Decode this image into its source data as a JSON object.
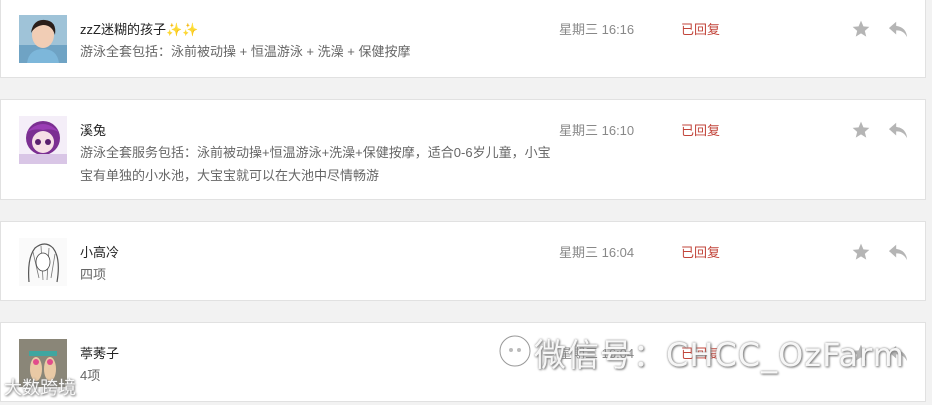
{
  "messages": [
    {
      "name": "zzZ迷糊的孩子✨✨",
      "text": "游泳全套包括：泳前被动操 + 恒温游泳 + 洗澡 + 保健按摩",
      "time": "星期三 16:16",
      "status": "已回复",
      "avatar": "photo-avatar-woman"
    },
    {
      "name": "溪兔",
      "text": "游泳全套服务包括：泳前被动操+恒温游泳+洗澡+保健按摩，适合0-6岁儿童，小宝宝有单独的小水池，大宝宝就可以在大池中尽情畅游",
      "time": "星期三 16:10",
      "status": "已回复",
      "avatar": "cartoon-avatar-purple-girl"
    },
    {
      "name": "小高冷",
      "text": "四项",
      "time": "星期三 16:04",
      "status": "已回复",
      "avatar": "sketch-avatar"
    },
    {
      "name": "葶莠子",
      "text": "4项",
      "time": "星期三 16:04",
      "status": "已回复",
      "avatar": "photo-avatar-feet"
    }
  ],
  "icons": {
    "star": "star-icon",
    "reply": "reply-icon"
  },
  "colors": {
    "status": "#c2453b",
    "icon": "#b5b5b5"
  },
  "watermarks": {
    "main": "微信号：CHCC_OzFarm",
    "corner": "大数跨境"
  }
}
